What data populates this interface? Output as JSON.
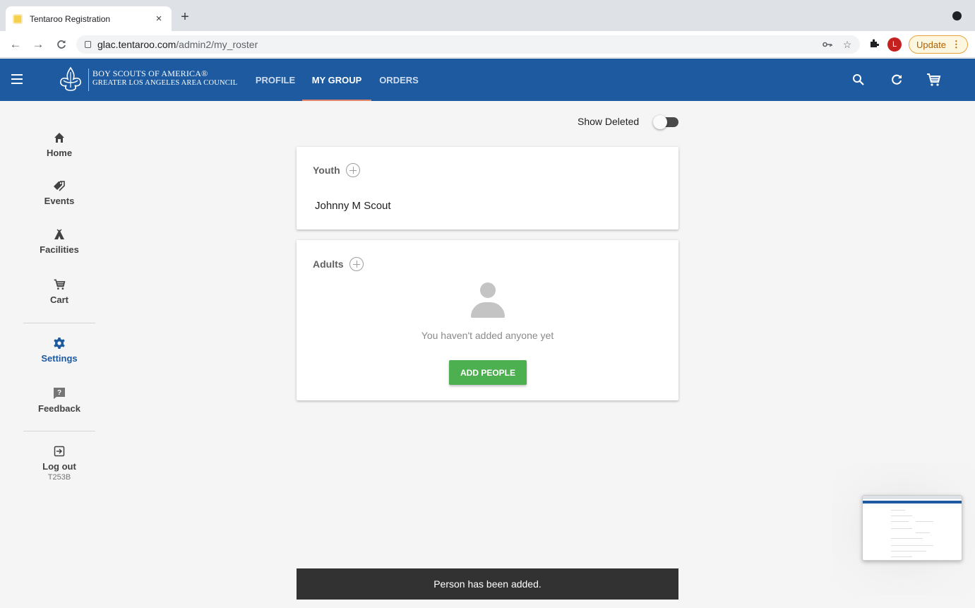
{
  "browser": {
    "tab_title": "Tentaroo Registration",
    "tab_close": "×",
    "new_tab": "+",
    "url_host": "glac.tentaroo.com",
    "url_path": "/admin2/my_roster",
    "profile_initial": "L",
    "update_label": "Update",
    "update_menu": "⋮"
  },
  "appbar": {
    "org_line1": "BOY SCOUTS OF AMERICA®",
    "org_line2": "GREATER LOS ANGELES AREA COUNCIL",
    "tabs": [
      {
        "label": "PROFILE",
        "active": false
      },
      {
        "label": "MY GROUP",
        "active": true
      },
      {
        "label": "ORDERS",
        "active": false
      }
    ],
    "colors": {
      "bar": "#1d5aa0",
      "active_indicator": "#e0876a"
    }
  },
  "sidebar": {
    "items": [
      {
        "label": "Home",
        "icon": "home-icon"
      },
      {
        "label": "Events",
        "icon": "tags-icon"
      },
      {
        "label": "Facilities",
        "icon": "tent-icon"
      },
      {
        "label": "Cart",
        "icon": "cart-icon"
      },
      {
        "label": "Settings",
        "icon": "gear-icon",
        "active": true
      },
      {
        "label": "Feedback",
        "icon": "feedback-icon"
      },
      {
        "label": "Log out",
        "icon": "logout-icon",
        "sub": "T253B"
      }
    ]
  },
  "main": {
    "show_deleted_label": "Show Deleted",
    "youth": {
      "title": "Youth",
      "people": [
        "Johnny M Scout"
      ]
    },
    "adults": {
      "title": "Adults",
      "empty_text": "You haven't added anyone yet",
      "add_button": "ADD PEOPLE"
    }
  },
  "snackbar": {
    "message": "Person has been added."
  }
}
